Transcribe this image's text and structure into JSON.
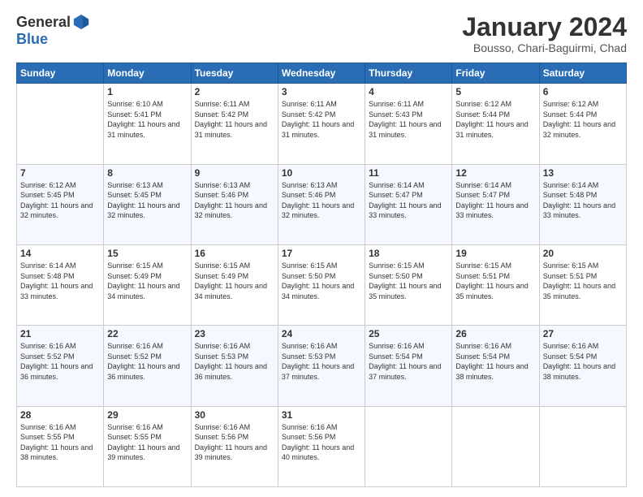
{
  "logo": {
    "general": "General",
    "blue": "Blue"
  },
  "header": {
    "month": "January 2024",
    "location": "Bousso, Chari-Baguirmi, Chad"
  },
  "weekdays": [
    "Sunday",
    "Monday",
    "Tuesday",
    "Wednesday",
    "Thursday",
    "Friday",
    "Saturday"
  ],
  "weeks": [
    [
      {
        "day": "",
        "sunrise": "",
        "sunset": "",
        "daylight": ""
      },
      {
        "day": "1",
        "sunrise": "Sunrise: 6:10 AM",
        "sunset": "Sunset: 5:41 PM",
        "daylight": "Daylight: 11 hours and 31 minutes."
      },
      {
        "day": "2",
        "sunrise": "Sunrise: 6:11 AM",
        "sunset": "Sunset: 5:42 PM",
        "daylight": "Daylight: 11 hours and 31 minutes."
      },
      {
        "day": "3",
        "sunrise": "Sunrise: 6:11 AM",
        "sunset": "Sunset: 5:42 PM",
        "daylight": "Daylight: 11 hours and 31 minutes."
      },
      {
        "day": "4",
        "sunrise": "Sunrise: 6:11 AM",
        "sunset": "Sunset: 5:43 PM",
        "daylight": "Daylight: 11 hours and 31 minutes."
      },
      {
        "day": "5",
        "sunrise": "Sunrise: 6:12 AM",
        "sunset": "Sunset: 5:44 PM",
        "daylight": "Daylight: 11 hours and 31 minutes."
      },
      {
        "day": "6",
        "sunrise": "Sunrise: 6:12 AM",
        "sunset": "Sunset: 5:44 PM",
        "daylight": "Daylight: 11 hours and 32 minutes."
      }
    ],
    [
      {
        "day": "7",
        "sunrise": "Sunrise: 6:12 AM",
        "sunset": "Sunset: 5:45 PM",
        "daylight": "Daylight: 11 hours and 32 minutes."
      },
      {
        "day": "8",
        "sunrise": "Sunrise: 6:13 AM",
        "sunset": "Sunset: 5:45 PM",
        "daylight": "Daylight: 11 hours and 32 minutes."
      },
      {
        "day": "9",
        "sunrise": "Sunrise: 6:13 AM",
        "sunset": "Sunset: 5:46 PM",
        "daylight": "Daylight: 11 hours and 32 minutes."
      },
      {
        "day": "10",
        "sunrise": "Sunrise: 6:13 AM",
        "sunset": "Sunset: 5:46 PM",
        "daylight": "Daylight: 11 hours and 32 minutes."
      },
      {
        "day": "11",
        "sunrise": "Sunrise: 6:14 AM",
        "sunset": "Sunset: 5:47 PM",
        "daylight": "Daylight: 11 hours and 33 minutes."
      },
      {
        "day": "12",
        "sunrise": "Sunrise: 6:14 AM",
        "sunset": "Sunset: 5:47 PM",
        "daylight": "Daylight: 11 hours and 33 minutes."
      },
      {
        "day": "13",
        "sunrise": "Sunrise: 6:14 AM",
        "sunset": "Sunset: 5:48 PM",
        "daylight": "Daylight: 11 hours and 33 minutes."
      }
    ],
    [
      {
        "day": "14",
        "sunrise": "Sunrise: 6:14 AM",
        "sunset": "Sunset: 5:48 PM",
        "daylight": "Daylight: 11 hours and 33 minutes."
      },
      {
        "day": "15",
        "sunrise": "Sunrise: 6:15 AM",
        "sunset": "Sunset: 5:49 PM",
        "daylight": "Daylight: 11 hours and 34 minutes."
      },
      {
        "day": "16",
        "sunrise": "Sunrise: 6:15 AM",
        "sunset": "Sunset: 5:49 PM",
        "daylight": "Daylight: 11 hours and 34 minutes."
      },
      {
        "day": "17",
        "sunrise": "Sunrise: 6:15 AM",
        "sunset": "Sunset: 5:50 PM",
        "daylight": "Daylight: 11 hours and 34 minutes."
      },
      {
        "day": "18",
        "sunrise": "Sunrise: 6:15 AM",
        "sunset": "Sunset: 5:50 PM",
        "daylight": "Daylight: 11 hours and 35 minutes."
      },
      {
        "day": "19",
        "sunrise": "Sunrise: 6:15 AM",
        "sunset": "Sunset: 5:51 PM",
        "daylight": "Daylight: 11 hours and 35 minutes."
      },
      {
        "day": "20",
        "sunrise": "Sunrise: 6:15 AM",
        "sunset": "Sunset: 5:51 PM",
        "daylight": "Daylight: 11 hours and 35 minutes."
      }
    ],
    [
      {
        "day": "21",
        "sunrise": "Sunrise: 6:16 AM",
        "sunset": "Sunset: 5:52 PM",
        "daylight": "Daylight: 11 hours and 36 minutes."
      },
      {
        "day": "22",
        "sunrise": "Sunrise: 6:16 AM",
        "sunset": "Sunset: 5:52 PM",
        "daylight": "Daylight: 11 hours and 36 minutes."
      },
      {
        "day": "23",
        "sunrise": "Sunrise: 6:16 AM",
        "sunset": "Sunset: 5:53 PM",
        "daylight": "Daylight: 11 hours and 36 minutes."
      },
      {
        "day": "24",
        "sunrise": "Sunrise: 6:16 AM",
        "sunset": "Sunset: 5:53 PM",
        "daylight": "Daylight: 11 hours and 37 minutes."
      },
      {
        "day": "25",
        "sunrise": "Sunrise: 6:16 AM",
        "sunset": "Sunset: 5:54 PM",
        "daylight": "Daylight: 11 hours and 37 minutes."
      },
      {
        "day": "26",
        "sunrise": "Sunrise: 6:16 AM",
        "sunset": "Sunset: 5:54 PM",
        "daylight": "Daylight: 11 hours and 38 minutes."
      },
      {
        "day": "27",
        "sunrise": "Sunrise: 6:16 AM",
        "sunset": "Sunset: 5:54 PM",
        "daylight": "Daylight: 11 hours and 38 minutes."
      }
    ],
    [
      {
        "day": "28",
        "sunrise": "Sunrise: 6:16 AM",
        "sunset": "Sunset: 5:55 PM",
        "daylight": "Daylight: 11 hours and 38 minutes."
      },
      {
        "day": "29",
        "sunrise": "Sunrise: 6:16 AM",
        "sunset": "Sunset: 5:55 PM",
        "daylight": "Daylight: 11 hours and 39 minutes."
      },
      {
        "day": "30",
        "sunrise": "Sunrise: 6:16 AM",
        "sunset": "Sunset: 5:56 PM",
        "daylight": "Daylight: 11 hours and 39 minutes."
      },
      {
        "day": "31",
        "sunrise": "Sunrise: 6:16 AM",
        "sunset": "Sunset: 5:56 PM",
        "daylight": "Daylight: 11 hours and 40 minutes."
      },
      {
        "day": "",
        "sunrise": "",
        "sunset": "",
        "daylight": ""
      },
      {
        "day": "",
        "sunrise": "",
        "sunset": "",
        "daylight": ""
      },
      {
        "day": "",
        "sunrise": "",
        "sunset": "",
        "daylight": ""
      }
    ]
  ]
}
